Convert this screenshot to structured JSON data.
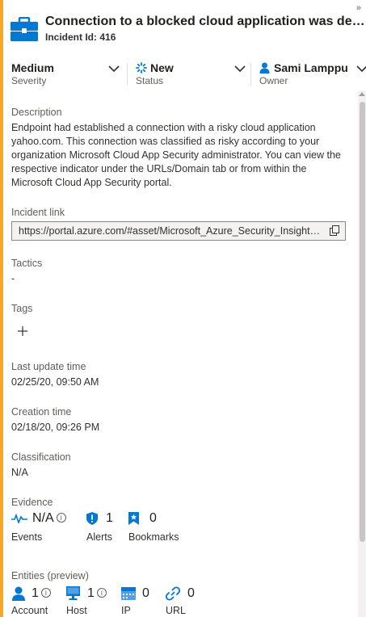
{
  "header": {
    "title": "Connection to a blocked cloud application was detec...",
    "incident_id_label": "Incident Id:",
    "incident_id": "416",
    "expand_glyph": "»"
  },
  "selectors": {
    "severity": {
      "value": "Medium",
      "caption": "Severity"
    },
    "status": {
      "value": "New",
      "caption": "Status"
    },
    "owner": {
      "value": "Sami Lamppu",
      "caption": "Owner"
    }
  },
  "details": {
    "description_label": "Description",
    "description": "Endpoint had established a connection with a risky cloud application yahoo.com. This connection was classified as risky according to your organization Microsoft Cloud App Security administrator. You can view the respective indicator under the URLs/Domain tab or from within the Microsoft Cloud App Security portal.",
    "incident_link_label": "Incident link",
    "incident_link": "https://portal.azure.com/#asset/Microsoft_Azure_Security_Insights/Incident/subscriptions/",
    "tactics_label": "Tactics",
    "tactics_value": "-",
    "tags_label": "Tags",
    "last_update_label": "Last update time",
    "last_update_value": "02/25/20, 09:50 AM",
    "creation_label": "Creation time",
    "creation_value": "02/18/20, 09:26 PM",
    "classification_label": "Classification",
    "classification_value": "N/A"
  },
  "evidence": {
    "label": "Evidence",
    "events": {
      "value": "N/A",
      "caption": "Events"
    },
    "alerts": {
      "value": "1",
      "caption": "Alerts"
    },
    "bookmarks": {
      "value": "0",
      "caption": "Bookmarks"
    }
  },
  "entities": {
    "label": "Entities (preview)",
    "account": {
      "value": "1",
      "caption": "Account"
    },
    "host": {
      "value": "1",
      "caption": "Host"
    },
    "ip": {
      "value": "0",
      "caption": "IP"
    },
    "url": {
      "value": "0",
      "caption": "URL"
    }
  },
  "colors": {
    "accent": "#f7a72a",
    "brand_blue": "#0078d4"
  }
}
